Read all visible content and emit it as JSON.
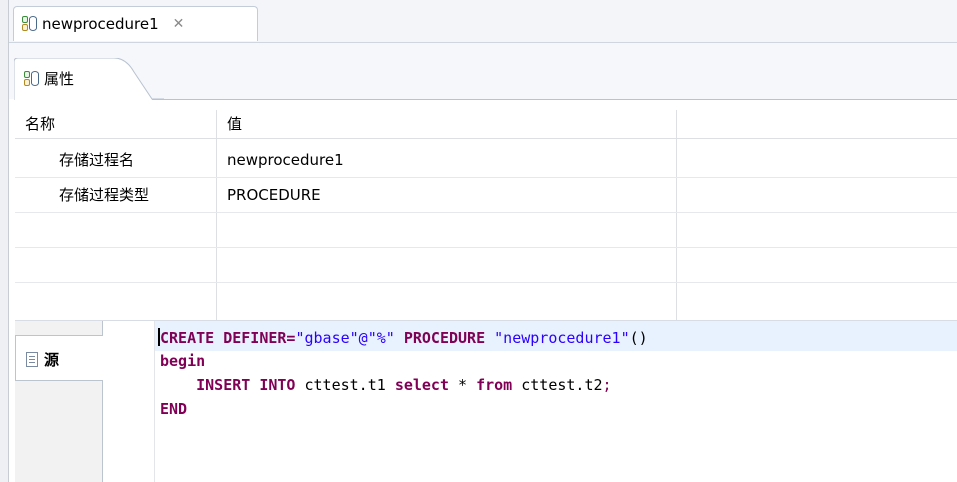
{
  "editor_tab": {
    "label": "newprocedure1",
    "close_glyph": "✕"
  },
  "properties": {
    "tab_label": "属性",
    "columns": {
      "name": "名称",
      "value": "值"
    },
    "rows": [
      {
        "name": "存储过程名",
        "value": "newprocedure1"
      },
      {
        "name": "存储过程类型",
        "value": "PROCEDURE"
      }
    ]
  },
  "source": {
    "tab_label": "源",
    "code": {
      "l1_kw1": "CREATE DEFINER=",
      "l1_str1": "\"gbase\"@\"%\"",
      "l1_kw2": " PROCEDURE ",
      "l1_str2": "\"newprocedure1\"",
      "l1_rest": "()",
      "l2": "begin",
      "l3_indent": "    ",
      "l3_kw1": "INSERT INTO",
      "l3_t1": " cttest.t1 ",
      "l3_kw2": "select",
      "l3_t2": " * ",
      "l3_kw3": "from",
      "l3_t3": " cttest.t2",
      "l3_semi": ";",
      "l4": "END"
    }
  },
  "icons": {
    "editor_tab_icon": "procedure-db-icon",
    "properties_icon": "procedure-db-icon",
    "source_icon": "document-icon",
    "close_icon": "close-icon"
  },
  "colors": {
    "keyword": "#7f0055",
    "string": "#2a00ff",
    "current_line": "#e8f2fe"
  }
}
